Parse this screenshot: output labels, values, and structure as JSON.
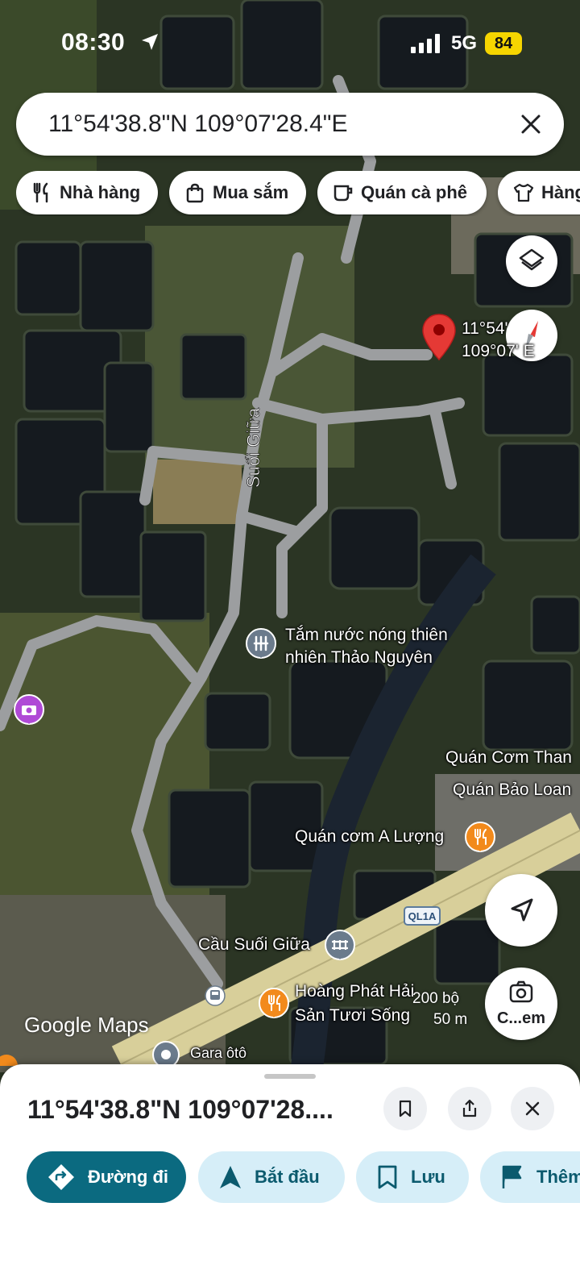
{
  "status": {
    "time": "08:30",
    "network": "5G",
    "battery": "84"
  },
  "search": {
    "query": "11°54'38.8\"N 109°07'28.4\"E"
  },
  "chips": [
    {
      "label": "Nhà hàng",
      "icon": "fork-knife-icon"
    },
    {
      "label": "Mua sắm",
      "icon": "shopping-bag-icon"
    },
    {
      "label": "Quán cà phê",
      "icon": "coffee-cup-icon"
    },
    {
      "label": "Hàng",
      "icon": "shirt-icon"
    }
  ],
  "map": {
    "pin_label_line1": "11°54'",
    "pin_label_line2": "109°07'  E",
    "road_label": "Suối Giữa",
    "places": {
      "hotspring_line1": "Tắm nước nóng thiên",
      "hotspring_line2": "nhiên Thảo Nguyên",
      "quan_com_than": "Quán Cơm Than",
      "quan_bao_loan": "Quán Bảo Loan",
      "quan_com_a_luong": "Quán cơm A Lượng",
      "cau_suoi_giua": "Cầu Suối Giữa",
      "hoang_phat_line1": "Hoàng Phát Hải",
      "hoang_phat_line2": "Sản Tươi Sống",
      "gara": "Gara ôtô",
      "road_shield": "QL1A"
    },
    "scale_bar": {
      "imperial": "200 bộ",
      "metric": "50 m"
    },
    "lens_label": "C...em",
    "attribution": "Google Maps"
  },
  "sheet": {
    "title": "11°54'38.8\"N 109°07'28....",
    "actions": [
      {
        "label": "Đường đi",
        "icon": "directions-icon"
      },
      {
        "label": "Bắt đầu",
        "icon": "navigation-arrow-icon"
      },
      {
        "label": "Lưu",
        "icon": "bookmark-icon"
      },
      {
        "label": "Thêm",
        "icon": "flag-icon"
      }
    ]
  },
  "colors": {
    "primary_action": "#0b6a80",
    "secondary_action": "#d6eef8",
    "pin_red": "#e53935",
    "poi_orange": "#f28a1c",
    "poi_gray": "#6b7b8c",
    "poi_purple": "#b04ad6"
  }
}
